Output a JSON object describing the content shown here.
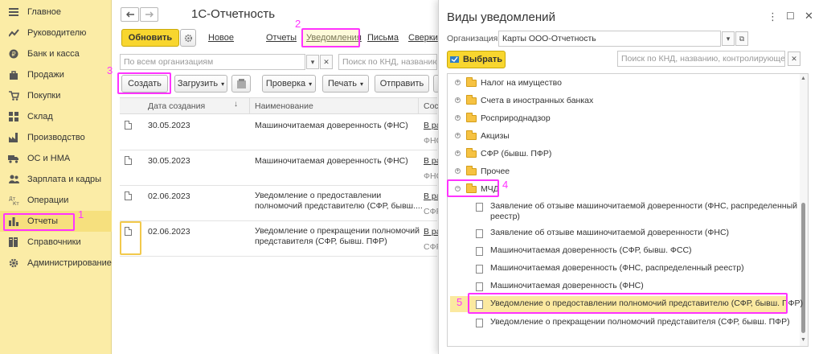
{
  "sidebar": {
    "items": [
      {
        "label": "Главное",
        "icon": "hamburger-icon"
      },
      {
        "label": "Руководителю",
        "icon": "trend-icon"
      },
      {
        "label": "Банк и касса",
        "icon": "coin-icon"
      },
      {
        "label": "Продажи",
        "icon": "bag-icon"
      },
      {
        "label": "Покупки",
        "icon": "cart-icon"
      },
      {
        "label": "Склад",
        "icon": "warehouse-icon"
      },
      {
        "label": "Производство",
        "icon": "factory-icon"
      },
      {
        "label": "ОС и НМА",
        "icon": "truck-icon"
      },
      {
        "label": "Зарплата и кадры",
        "icon": "people-icon"
      },
      {
        "label": "Операции",
        "icon": "dt-kt-icon"
      },
      {
        "label": "Отчеты",
        "icon": "bar-chart-icon"
      },
      {
        "label": "Справочники",
        "icon": "books-icon"
      },
      {
        "label": "Администрирование",
        "icon": "gear-icon"
      }
    ]
  },
  "main": {
    "title": "1С-Отчетность",
    "refresh_label": "Обновить",
    "menu": {
      "new": "Новое",
      "reports": "Отчеты",
      "notifications": "Уведомления",
      "letters": "Письма",
      "reconciliations": "Сверки"
    },
    "org_filter_placeholder": "По всем организациям",
    "search_placeholder": "Поиск по КНД, названию,",
    "toolbar": {
      "create": "Создать",
      "load": "Загрузить",
      "check": "Проверка",
      "print": "Печать",
      "send": "Отправить"
    },
    "table": {
      "col_date": "Дата создания",
      "col_name": "Наименование",
      "col_state": "Сос",
      "rows": [
        {
          "date": "30.05.2023",
          "name": "Машиночитаемая доверенность (ФНС)",
          "name2": "",
          "state": "В ра",
          "state2": "ФНС"
        },
        {
          "date": "30.05.2023",
          "name": "Машиночитаемая доверенность (ФНС)",
          "name2": "",
          "state": "В ра",
          "state2": "ФНС"
        },
        {
          "date": "02.06.2023",
          "name": "Уведомление о предоставлении",
          "name2": "полномочий представителю (СФР, бывш....",
          "state": "В ра",
          "state2": "СФР"
        },
        {
          "date": "02.06.2023",
          "name": "Уведомление о прекращении полномочий",
          "name2": "представителя (СФР, бывш. ПФР)",
          "state": "В ра",
          "state2": "СФР"
        }
      ]
    }
  },
  "dialog": {
    "title": "Виды уведомлений",
    "org_label": "Организация:",
    "org_value": "Карты ООО-Отчетность",
    "select_label": "Выбрать",
    "search_placeholder": "Поиск по КНД, названию, контролирующем...",
    "folders": [
      "Налог на имущество",
      "Счета в иностранных банках",
      "Росприроднадзор",
      "Акцизы",
      "СФР (бывш. ПФР)",
      "Прочее",
      "МЧД"
    ],
    "mchd_items": [
      "Заявление об отзыве машиночитаемой доверенности (ФНС, распределенный",
      "реестр)",
      "Заявление об отзыве машиночитаемой доверенности (ФНС)",
      "Машиночитаемая доверенность (СФР, бывш. ФСС)",
      "Машиночитаемая доверенность (ФНС, распределенный реестр)",
      "Машиночитаемая доверенность (ФНС)",
      "Уведомление о предоставлении полномочий представителю (СФР, бывш. ПФР)",
      "Уведомление о прекращении полномочий представителя (СФР, бывш. ПФР)"
    ]
  },
  "annotations": [
    "1",
    "2",
    "3",
    "4",
    "5"
  ],
  "colors": {
    "sidebar_bg": "#fbeca6",
    "primary_button": "#f8d62f",
    "highlight": "#ff33ff",
    "selected_row": "#fbe9a0",
    "folder": "#f6c242"
  }
}
